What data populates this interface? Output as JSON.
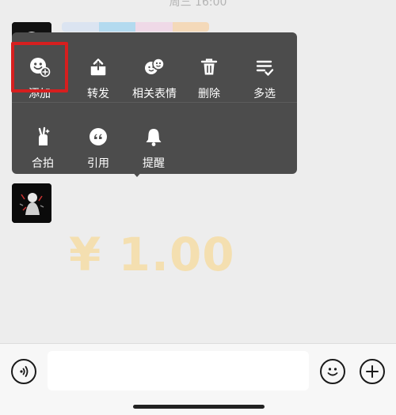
{
  "header": {
    "timestamp": "周三 16:00"
  },
  "context_menu": {
    "row1": [
      {
        "label": "添加",
        "icon": "add-sticker-icon"
      },
      {
        "label": "转发",
        "icon": "forward-icon"
      },
      {
        "label": "相关表情",
        "icon": "related-stickers-icon"
      },
      {
        "label": "删除",
        "icon": "delete-icon"
      },
      {
        "label": "多选",
        "icon": "multi-select-icon"
      }
    ],
    "row2": [
      {
        "label": "合拍",
        "icon": "sync-photo-icon"
      },
      {
        "label": "引用",
        "icon": "quote-icon"
      },
      {
        "label": "提醒",
        "icon": "reminder-bell-icon"
      }
    ]
  },
  "background_text": {
    "amount": "¥ 1.00"
  },
  "composer": {
    "voice_icon": "voice-icon",
    "emoji_icon": "emoji-icon",
    "plus_icon": "plus-icon"
  },
  "colors": {
    "menu_bg": "#4c4c4c",
    "highlight": "#d61f1f",
    "page_bg": "#ededed"
  }
}
